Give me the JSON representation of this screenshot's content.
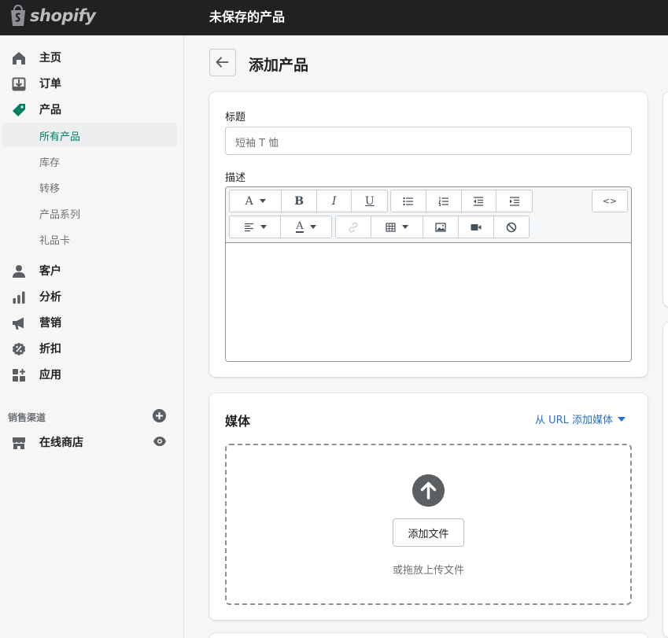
{
  "header": {
    "logo_text": "shopify",
    "title": "未保存的产品"
  },
  "sidebar": {
    "items": [
      {
        "label": "主页",
        "icon": "home-icon"
      },
      {
        "label": "订单",
        "icon": "orders-icon"
      },
      {
        "label": "产品",
        "icon": "tag-icon"
      },
      {
        "label": "客户",
        "icon": "customer-icon"
      },
      {
        "label": "分析",
        "icon": "analytics-icon"
      },
      {
        "label": "营销",
        "icon": "megaphone-icon"
      },
      {
        "label": "折扣",
        "icon": "discount-icon"
      },
      {
        "label": "应用",
        "icon": "apps-icon"
      }
    ],
    "product_subitems": [
      "所有产品",
      "库存",
      "转移",
      "产品系列",
      "礼品卡"
    ],
    "sales_channels_title": "销售渠道",
    "online_store_label": "在线商店"
  },
  "main": {
    "page_title": "添加产品",
    "title_field": {
      "label": "标题",
      "placeholder": "短袖 T 恤"
    },
    "description_label": "描述",
    "editor_toolbar": {
      "html_label": "<>"
    },
    "media": {
      "heading": "媒体",
      "url_link": "从 URL 添加媒体",
      "add_file_button": "添加文件",
      "drop_hint": "或拖放上传文件"
    }
  },
  "colors": {
    "topbar": "#202123",
    "active_nav": "#007f5f",
    "link": "#2c6ecb",
    "product_icon": "#008060"
  }
}
